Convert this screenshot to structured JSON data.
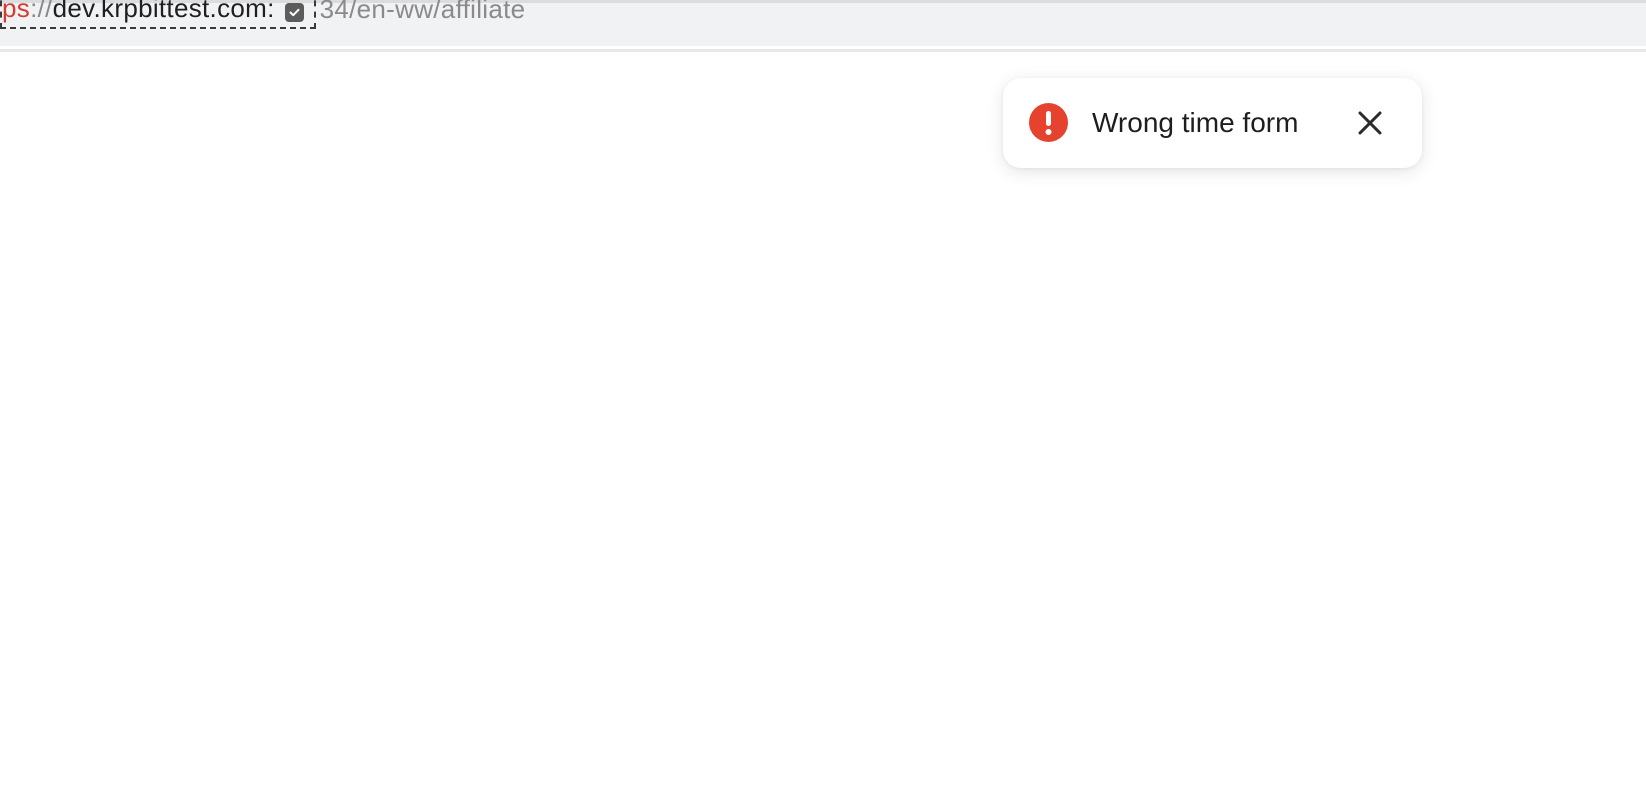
{
  "browser": {
    "url": {
      "scheme_fragment": "ps",
      "separator": "://",
      "host": "dev.krpbittest.com:",
      "path": "34/en-ww/affiliate"
    }
  },
  "toast": {
    "type": "error",
    "icon": "error-exclamation-icon",
    "message": "Wrong time form",
    "close_icon": "close-icon",
    "accent_color": "#e5432e"
  }
}
